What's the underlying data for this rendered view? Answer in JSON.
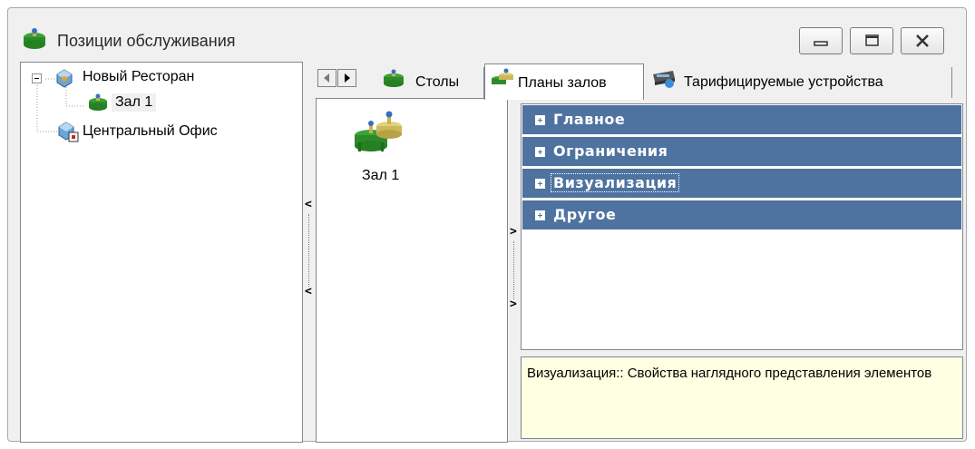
{
  "window": {
    "title": "Позиции обслуживания",
    "title_icon": "table-icon",
    "buttons": [
      "minimize-icon",
      "maximize-icon",
      "close-icon"
    ]
  },
  "tree": {
    "items": [
      {
        "label": "Новый Ресторан",
        "icon": "restaurant-icon",
        "expanded": true
      },
      {
        "label": "Зал 1",
        "icon": "hall-icon",
        "selected": true
      },
      {
        "label": "Центральный Офис",
        "icon": "office-icon"
      }
    ]
  },
  "tabs": [
    {
      "label": "Столы",
      "icon": "table-icon"
    },
    {
      "label": "Планы залов",
      "icon": "hall-plan-icon",
      "active": true
    },
    {
      "label": "Тарифицируемые устройства",
      "icon": "billing-device-icon"
    }
  ],
  "hall_list": {
    "items": [
      {
        "label": "Зал 1",
        "icon": "hall-plan-icon"
      }
    ]
  },
  "properties": {
    "categories": [
      {
        "label": "Главное"
      },
      {
        "label": "Ограничения"
      },
      {
        "label": "Визуализация",
        "selected": true
      },
      {
        "label": "Другое"
      }
    ],
    "description": "Визуализация:: Свойства наглядного представления элементов"
  },
  "colors": {
    "category_bg": "#4f73a0",
    "description_bg": "#ffffe1",
    "window_bg": "#f0f0f0"
  }
}
